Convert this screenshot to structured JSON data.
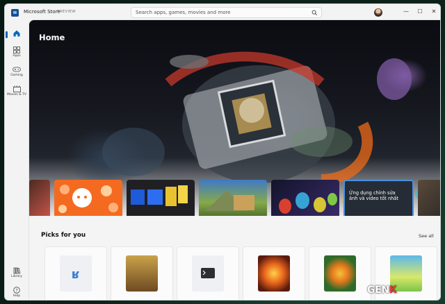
{
  "window": {
    "title": "Microsoft Store",
    "badge": "PREVIEW"
  },
  "search": {
    "placeholder": "Search apps, games, movies and more"
  },
  "controls": {
    "minimize": "—",
    "maximize": "☐",
    "close": "✕"
  },
  "sidebar": {
    "items": [
      {
        "id": "home",
        "label": "",
        "icon": "home-icon"
      },
      {
        "id": "apps",
        "label": "Apps",
        "icon": "apps-icon"
      },
      {
        "id": "gaming",
        "label": "Gaming",
        "icon": "gamepad-icon"
      },
      {
        "id": "movies",
        "label": "Movies & TV",
        "icon": "movies-icon"
      }
    ],
    "bottom": [
      {
        "id": "library",
        "label": "Library",
        "icon": "library-icon"
      },
      {
        "id": "help",
        "label": "Help",
        "icon": "help-icon"
      }
    ]
  },
  "hero": {
    "title": "Home"
  },
  "carousel": {
    "items": [
      {
        "name": "hero-card-1",
        "caption": ""
      },
      {
        "name": "hero-card-reddit",
        "caption": ""
      },
      {
        "name": "hero-card-dolby",
        "caption": ""
      },
      {
        "name": "hero-card-game",
        "caption": ""
      },
      {
        "name": "hero-card-among",
        "caption": ""
      },
      {
        "name": "hero-card-photo",
        "caption": "Ứng dụng chỉnh sửa ảnh và video tốt nhất"
      },
      {
        "name": "hero-card-7",
        "caption": ""
      }
    ],
    "accent": "#4a90e2"
  },
  "picks": {
    "title": "Picks for you",
    "see_all": "See all"
  },
  "watermark": {
    "main": "GEN",
    "accent": "K"
  }
}
